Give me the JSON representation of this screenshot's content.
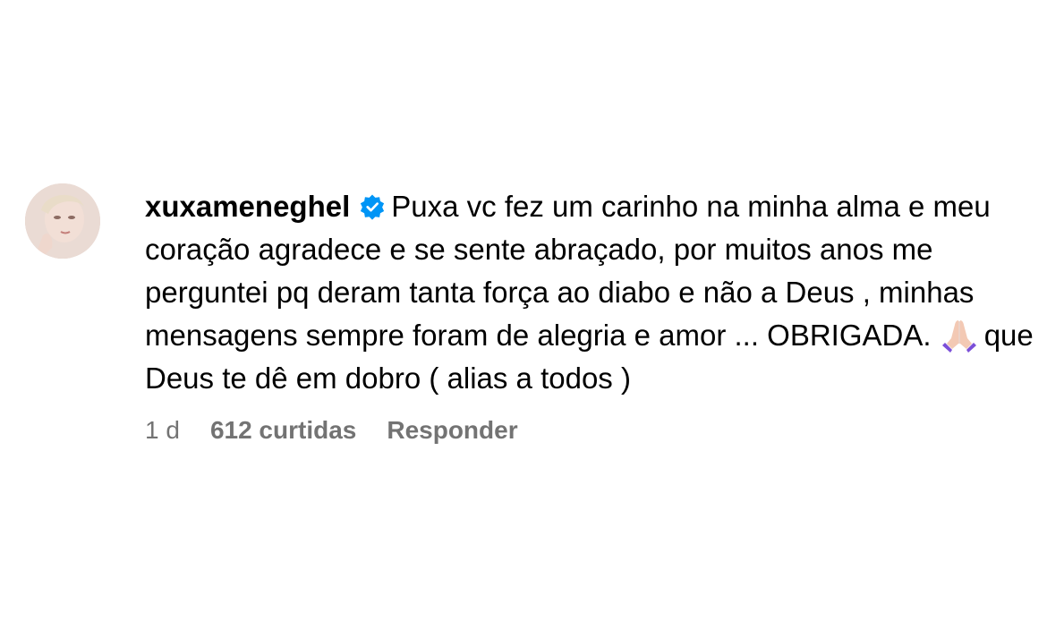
{
  "comment": {
    "username": "xuxameneghel",
    "verified_icon": "verified-badge-icon",
    "text_part1": "Puxa vc fez um carinho na minha alma e meu coração agradece e se sente abraçado, por muitos anos me perguntei pq deram tanta força ao diabo e não a Deus , minhas mensagens sempre foram de alegria e amor ... OBRIGADA.",
    "emoji": "praying-hands-icon",
    "text_part2": "que Deus te dê em dobro ( alias a todos )",
    "time": "1 d",
    "likes": "612 curtidas",
    "reply_label": "Responder"
  },
  "colors": {
    "verified_blue": "#0095f6",
    "meta_gray": "#737373",
    "emoji_purple": "#7b4fd8",
    "emoji_skin": "#f3c9b4"
  }
}
